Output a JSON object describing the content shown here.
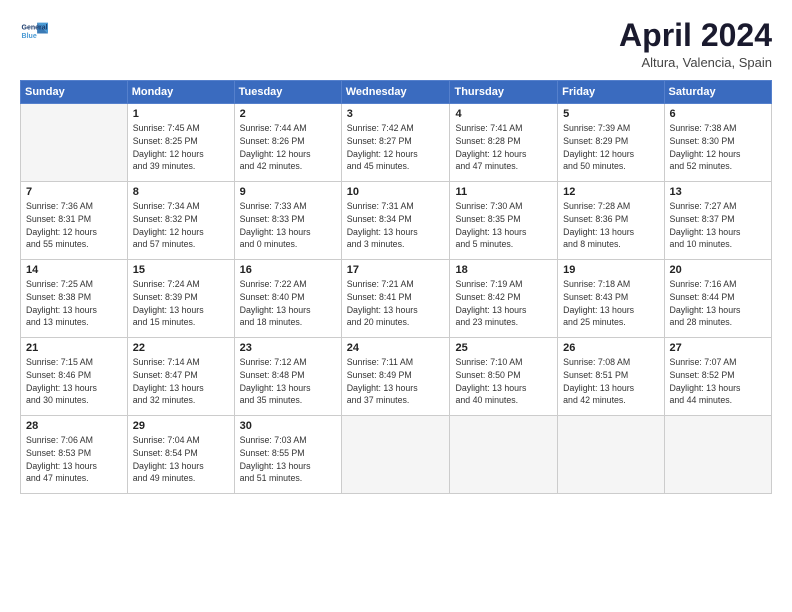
{
  "header": {
    "logo_line1": "General",
    "logo_line2": "Blue",
    "title": "April 2024",
    "subtitle": "Altura, Valencia, Spain"
  },
  "columns": [
    "Sunday",
    "Monday",
    "Tuesday",
    "Wednesday",
    "Thursday",
    "Friday",
    "Saturday"
  ],
  "weeks": [
    [
      {
        "day": "",
        "info": ""
      },
      {
        "day": "1",
        "info": "Sunrise: 7:45 AM\nSunset: 8:25 PM\nDaylight: 12 hours\nand 39 minutes."
      },
      {
        "day": "2",
        "info": "Sunrise: 7:44 AM\nSunset: 8:26 PM\nDaylight: 12 hours\nand 42 minutes."
      },
      {
        "day": "3",
        "info": "Sunrise: 7:42 AM\nSunset: 8:27 PM\nDaylight: 12 hours\nand 45 minutes."
      },
      {
        "day": "4",
        "info": "Sunrise: 7:41 AM\nSunset: 8:28 PM\nDaylight: 12 hours\nand 47 minutes."
      },
      {
        "day": "5",
        "info": "Sunrise: 7:39 AM\nSunset: 8:29 PM\nDaylight: 12 hours\nand 50 minutes."
      },
      {
        "day": "6",
        "info": "Sunrise: 7:38 AM\nSunset: 8:30 PM\nDaylight: 12 hours\nand 52 minutes."
      }
    ],
    [
      {
        "day": "7",
        "info": "Sunrise: 7:36 AM\nSunset: 8:31 PM\nDaylight: 12 hours\nand 55 minutes."
      },
      {
        "day": "8",
        "info": "Sunrise: 7:34 AM\nSunset: 8:32 PM\nDaylight: 12 hours\nand 57 minutes."
      },
      {
        "day": "9",
        "info": "Sunrise: 7:33 AM\nSunset: 8:33 PM\nDaylight: 13 hours\nand 0 minutes."
      },
      {
        "day": "10",
        "info": "Sunrise: 7:31 AM\nSunset: 8:34 PM\nDaylight: 13 hours\nand 3 minutes."
      },
      {
        "day": "11",
        "info": "Sunrise: 7:30 AM\nSunset: 8:35 PM\nDaylight: 13 hours\nand 5 minutes."
      },
      {
        "day": "12",
        "info": "Sunrise: 7:28 AM\nSunset: 8:36 PM\nDaylight: 13 hours\nand 8 minutes."
      },
      {
        "day": "13",
        "info": "Sunrise: 7:27 AM\nSunset: 8:37 PM\nDaylight: 13 hours\nand 10 minutes."
      }
    ],
    [
      {
        "day": "14",
        "info": "Sunrise: 7:25 AM\nSunset: 8:38 PM\nDaylight: 13 hours\nand 13 minutes."
      },
      {
        "day": "15",
        "info": "Sunrise: 7:24 AM\nSunset: 8:39 PM\nDaylight: 13 hours\nand 15 minutes."
      },
      {
        "day": "16",
        "info": "Sunrise: 7:22 AM\nSunset: 8:40 PM\nDaylight: 13 hours\nand 18 minutes."
      },
      {
        "day": "17",
        "info": "Sunrise: 7:21 AM\nSunset: 8:41 PM\nDaylight: 13 hours\nand 20 minutes."
      },
      {
        "day": "18",
        "info": "Sunrise: 7:19 AM\nSunset: 8:42 PM\nDaylight: 13 hours\nand 23 minutes."
      },
      {
        "day": "19",
        "info": "Sunrise: 7:18 AM\nSunset: 8:43 PM\nDaylight: 13 hours\nand 25 minutes."
      },
      {
        "day": "20",
        "info": "Sunrise: 7:16 AM\nSunset: 8:44 PM\nDaylight: 13 hours\nand 28 minutes."
      }
    ],
    [
      {
        "day": "21",
        "info": "Sunrise: 7:15 AM\nSunset: 8:46 PM\nDaylight: 13 hours\nand 30 minutes."
      },
      {
        "day": "22",
        "info": "Sunrise: 7:14 AM\nSunset: 8:47 PM\nDaylight: 13 hours\nand 32 minutes."
      },
      {
        "day": "23",
        "info": "Sunrise: 7:12 AM\nSunset: 8:48 PM\nDaylight: 13 hours\nand 35 minutes."
      },
      {
        "day": "24",
        "info": "Sunrise: 7:11 AM\nSunset: 8:49 PM\nDaylight: 13 hours\nand 37 minutes."
      },
      {
        "day": "25",
        "info": "Sunrise: 7:10 AM\nSunset: 8:50 PM\nDaylight: 13 hours\nand 40 minutes."
      },
      {
        "day": "26",
        "info": "Sunrise: 7:08 AM\nSunset: 8:51 PM\nDaylight: 13 hours\nand 42 minutes."
      },
      {
        "day": "27",
        "info": "Sunrise: 7:07 AM\nSunset: 8:52 PM\nDaylight: 13 hours\nand 44 minutes."
      }
    ],
    [
      {
        "day": "28",
        "info": "Sunrise: 7:06 AM\nSunset: 8:53 PM\nDaylight: 13 hours\nand 47 minutes."
      },
      {
        "day": "29",
        "info": "Sunrise: 7:04 AM\nSunset: 8:54 PM\nDaylight: 13 hours\nand 49 minutes."
      },
      {
        "day": "30",
        "info": "Sunrise: 7:03 AM\nSunset: 8:55 PM\nDaylight: 13 hours\nand 51 minutes."
      },
      {
        "day": "",
        "info": ""
      },
      {
        "day": "",
        "info": ""
      },
      {
        "day": "",
        "info": ""
      },
      {
        "day": "",
        "info": ""
      }
    ]
  ]
}
